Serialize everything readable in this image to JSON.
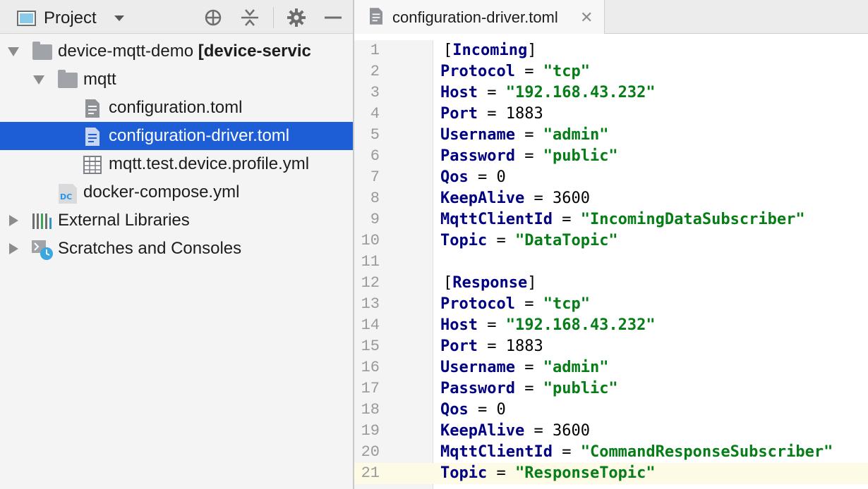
{
  "project_panel": {
    "title": "Project",
    "tree": [
      {
        "label": "device-mqtt-demo",
        "suffix": "[device-servic",
        "type": "folder",
        "expanded": true,
        "depth": 0
      },
      {
        "label": "mqtt",
        "type": "folder",
        "expanded": true,
        "depth": 1
      },
      {
        "label": "configuration.toml",
        "type": "file",
        "depth": 2
      },
      {
        "label": "configuration-driver.toml",
        "type": "file",
        "depth": 2,
        "selected": true
      },
      {
        "label": "mqtt.test.device.profile.yml",
        "type": "yaml-table",
        "depth": 2
      },
      {
        "label": "docker-compose.yml",
        "type": "docker-compose",
        "icon_text": "DC",
        "depth": 1
      },
      {
        "label": "External Libraries",
        "type": "libraries",
        "expanded": false,
        "depth": 0
      },
      {
        "label": "Scratches and Consoles",
        "type": "scratches",
        "expanded": false,
        "depth": 0
      }
    ]
  },
  "editor": {
    "tab_label": "configuration-driver.toml",
    "tab_close": "✕",
    "current_line": 21,
    "lines": [
      {
        "num": "1",
        "key": "",
        "op": "",
        "val": "",
        "section": "Incoming"
      },
      {
        "num": "2",
        "key": "Protocol",
        "op": " = ",
        "val": "\"tcp\"",
        "vtype": "s"
      },
      {
        "num": "3",
        "key": "Host",
        "op": " = ",
        "val": "\"192.168.43.232\"",
        "vtype": "s"
      },
      {
        "num": "4",
        "key": "Port",
        "op": " = ",
        "val": "1883",
        "vtype": "n"
      },
      {
        "num": "5",
        "key": "Username",
        "op": " = ",
        "val": "\"admin\"",
        "vtype": "s"
      },
      {
        "num": "6",
        "key": "Password",
        "op": " = ",
        "val": "\"public\"",
        "vtype": "s"
      },
      {
        "num": "7",
        "key": "Qos",
        "op": " = ",
        "val": "0",
        "vtype": "n"
      },
      {
        "num": "8",
        "key": "KeepAlive",
        "op": " = ",
        "val": "3600",
        "vtype": "n"
      },
      {
        "num": "9",
        "key": "MqttClientId",
        "op": " = ",
        "val": "\"IncomingDataSubscriber\"",
        "vtype": "s"
      },
      {
        "num": "10",
        "key": "Topic",
        "op": " = ",
        "val": "\"DataTopic\"",
        "vtype": "s"
      },
      {
        "num": "11",
        "key": "",
        "op": "",
        "val": ""
      },
      {
        "num": "12",
        "key": "",
        "op": "",
        "val": "",
        "section": "Response"
      },
      {
        "num": "13",
        "key": "Protocol",
        "op": " = ",
        "val": "\"tcp\"",
        "vtype": "s"
      },
      {
        "num": "14",
        "key": "Host",
        "op": " = ",
        "val": "\"192.168.43.232\"",
        "vtype": "s"
      },
      {
        "num": "15",
        "key": "Port",
        "op": " = ",
        "val": "1883",
        "vtype": "n"
      },
      {
        "num": "16",
        "key": "Username",
        "op": " = ",
        "val": "\"admin\"",
        "vtype": "s"
      },
      {
        "num": "17",
        "key": "Password",
        "op": " = ",
        "val": "\"public\"",
        "vtype": "s"
      },
      {
        "num": "18",
        "key": "Qos",
        "op": " = ",
        "val": "0",
        "vtype": "n"
      },
      {
        "num": "19",
        "key": "KeepAlive",
        "op": " = ",
        "val": "3600",
        "vtype": "n"
      },
      {
        "num": "20",
        "key": "MqttClientId",
        "op": " = ",
        "val": "\"CommandResponseSubscriber\"",
        "vtype": "s"
      },
      {
        "num": "21",
        "key": "Topic",
        "op": " = ",
        "val": "\"ResponseTopic\"",
        "vtype": "s"
      }
    ]
  },
  "colors": {
    "selection": "#1d5ed6",
    "keyword": "#000080",
    "string": "#067d17",
    "current_line": "#fdfbe6"
  }
}
